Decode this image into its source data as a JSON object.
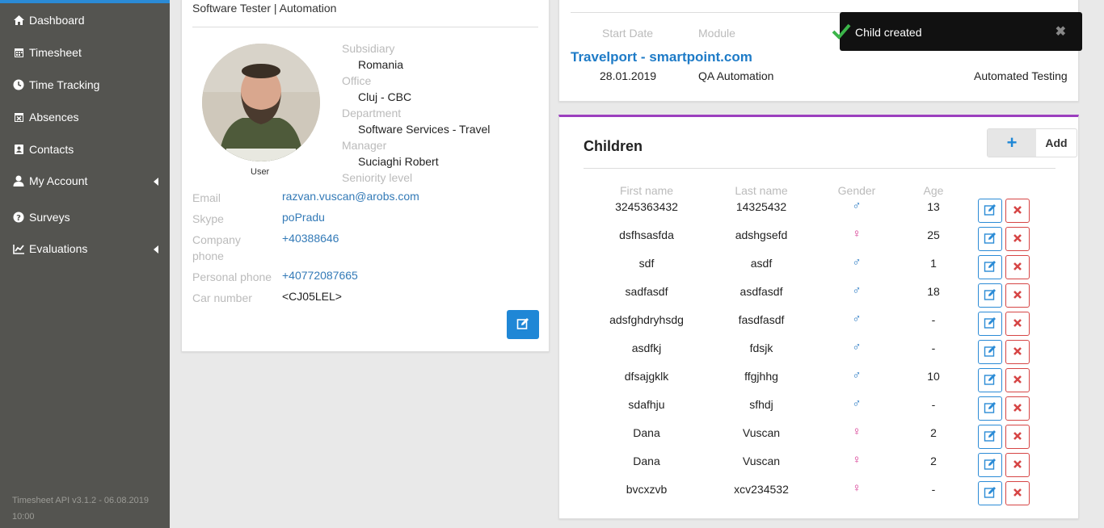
{
  "sidebar": {
    "items": [
      {
        "label": "Dashboard",
        "icon": "home-icon"
      },
      {
        "label": "Timesheet",
        "icon": "calendar-icon"
      },
      {
        "label": "Time Tracking",
        "icon": "clock-icon"
      },
      {
        "label": "Absences",
        "icon": "calendar-x-icon"
      },
      {
        "label": "Contacts",
        "icon": "contact-card-icon"
      },
      {
        "label": "My Account",
        "icon": "user-icon"
      },
      {
        "label": "Surveys",
        "icon": "question-circle-icon"
      },
      {
        "label": "Evaluations",
        "icon": "line-chart-icon"
      }
    ],
    "version": "Timesheet API v3.1.2 - 06.08.2019 10:00"
  },
  "profile": {
    "job_title": "Software Tester | Automation",
    "avatar_label": "User",
    "subsidiary_label": "Subsidiary",
    "subsidiary": "Romania",
    "office_label": "Office",
    "office": "Cluj - CBC",
    "department_label": "Department",
    "department": "Software Services - Travel",
    "manager_label": "Manager",
    "manager": "Suciaghi Robert",
    "seniority_label": "Seniority level",
    "email_label": "Email",
    "email": "razvan.vuscan@arobs.com",
    "skype_label": "Skype",
    "skype": "poPradu",
    "company_phone_label": "Company phone",
    "company_phone": "+40388646",
    "personal_phone_label": "Personal phone",
    "personal_phone": "+40772087665",
    "car_number_label": "Car number",
    "car_number": "<CJ05LEL>"
  },
  "project": {
    "start_date_label": "Start Date",
    "module_label": "Module",
    "name": "Travelport - smartpoint.com",
    "start_date": "28.01.2019",
    "module": "QA Automation",
    "role": "Automated Testing"
  },
  "toast": {
    "message": "Child created",
    "close": "✖"
  },
  "children": {
    "title": "Children",
    "add_label": "Add",
    "add_symbol": "+",
    "columns": {
      "first_name": "First name",
      "last_name": "Last name",
      "gender": "Gender",
      "age": "Age"
    },
    "colors": {
      "male": "#2b7bc4",
      "female": "#d6338f"
    },
    "rows": [
      {
        "first": "3245363432",
        "last": "14325432",
        "gender": "male",
        "age": "13"
      },
      {
        "first": "dsfhsasfda",
        "last": "adshgsefd",
        "gender": "female",
        "age": "25"
      },
      {
        "first": "sdf",
        "last": "asdf",
        "gender": "male",
        "age": "1"
      },
      {
        "first": "sadfasdf",
        "last": "asdfasdf",
        "gender": "male",
        "age": "18"
      },
      {
        "first": "adsfghdryhsdg",
        "last": "fasdfasdf",
        "gender": "male",
        "age": "-"
      },
      {
        "first": "asdfkj",
        "last": "fdsjk",
        "gender": "male",
        "age": "-"
      },
      {
        "first": "dfsajgklk",
        "last": "ffgjhhg",
        "gender": "male",
        "age": "10"
      },
      {
        "first": "sdafhju",
        "last": "sfhdj",
        "gender": "male",
        "age": "-"
      },
      {
        "first": "Dana",
        "last": "Vuscan",
        "gender": "female",
        "age": "2"
      },
      {
        "first": "Dana",
        "last": "Vuscan",
        "gender": "female",
        "age": "2"
      },
      {
        "first": "bvcxzvb",
        "last": "xcv234532",
        "gender": "female",
        "age": "-"
      }
    ]
  }
}
